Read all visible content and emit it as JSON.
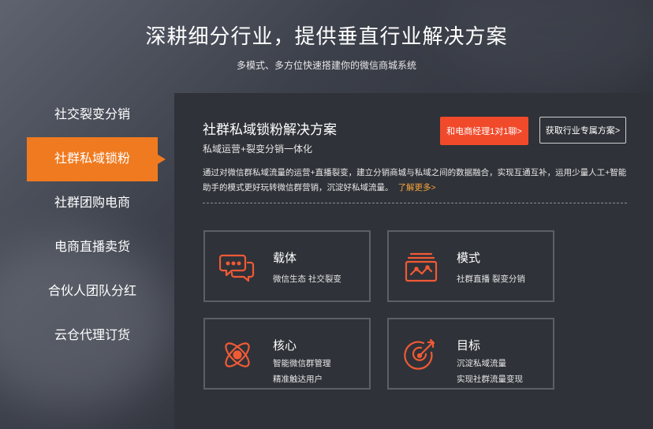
{
  "header": {
    "title": "深耕细分行业，提供垂直行业解决方案",
    "subtitle": "多模式、多方位快速搭建你的微信商城系统"
  },
  "tabs": [
    {
      "label": "社交裂变分销"
    },
    {
      "label": "社群私域锁粉"
    },
    {
      "label": "社群团购电商"
    },
    {
      "label": "电商直播卖货"
    },
    {
      "label": "合伙人团队分红"
    },
    {
      "label": "云仓代理订货"
    }
  ],
  "active_tab_index": 1,
  "panel": {
    "title": "社群私域锁粉解决方案",
    "subtitle": "私域运营+裂变分销一体化",
    "contact_button": "和电商经理1对1聊>",
    "plan_button": "获取行业专属方案>",
    "description": "通过对微信群私域流量的运营+直播裂变，建立分销商城与私域之间的数据融合，实现互通互补，运用少量人工+智能助手的模式更好玩转微信群营销，沉淀好私域流量。",
    "learn_more": "了解更多>"
  },
  "cards": [
    {
      "title": "载体",
      "lines": [
        "微信生态 社交裂变"
      ],
      "icon": "chat-bubbles-icon"
    },
    {
      "title": "模式",
      "lines": [
        "社群直播 裂变分销"
      ],
      "icon": "live-screen-icon"
    },
    {
      "title": "核心",
      "lines": [
        "智能微信群管理",
        "精准触达用户"
      ],
      "icon": "atom-icon"
    },
    {
      "title": "目标",
      "lines": [
        "沉淀私域流量",
        "实现社群流量变现"
      ],
      "icon": "target-icon"
    }
  ],
  "colors": {
    "accent_orange": "#f07a1f",
    "button_red": "#f04a2b",
    "link_orange": "#f7a43a",
    "icon_color": "#f05a35"
  }
}
